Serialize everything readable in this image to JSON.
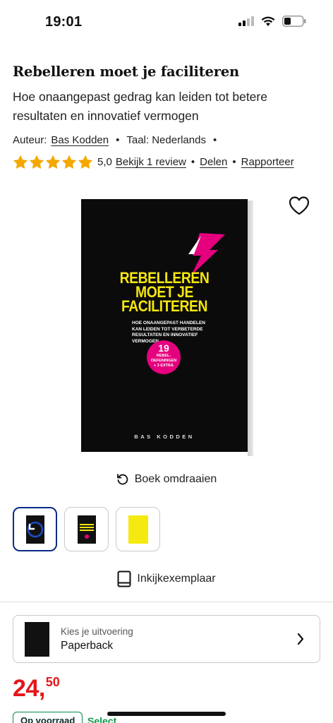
{
  "status_bar": {
    "time": "19:01"
  },
  "product": {
    "title": "Rebelleren moet je faciliteren",
    "subtitle": "Hoe onaangepast gedrag kan leiden tot betere resultaten en innovatief vermogen",
    "author_label": "Auteur:",
    "author": "Bas Kodden",
    "language_label": "Taal: Nederlands",
    "separator": "•",
    "rating": "5,0",
    "stars": 5,
    "review_link": "Bekijk 1 review",
    "share_link": "Delen",
    "report_link": "Rapporteer"
  },
  "cover": {
    "title_line1": "REBELLEREN",
    "title_line2": "MOET JE",
    "title_line3": "FACILITEREN",
    "sub1": "HOE ONAANGEPAST HANDELEN",
    "sub2": "KAN LEIDEN TOT VERBETERDE",
    "sub3": "RESULTATEN EN INNOVATIEF",
    "sub4": "VERMOGEN",
    "badge_num": "19",
    "badge_line1": "REBEL-",
    "badge_line2": "OEFENINGEN",
    "badge_line3": "+ 3 EXTRA",
    "author": "BAS KODDEN"
  },
  "actions": {
    "flip_label": "Boek omdraaien",
    "preview_label": "Inkijkexemplaar"
  },
  "variant": {
    "label": "Kies je uitvoering",
    "value": "Paperback"
  },
  "price": {
    "main": "24,",
    "cents": "50"
  },
  "stock": {
    "badge": "Op voorraad",
    "select": "Select"
  },
  "colors": {
    "accent_blue": "#0a2a8a",
    "price_red": "#e4161a",
    "star_yellow": "#f5a800",
    "cover_yellow": "#f5e60f",
    "cover_pink": "#e5007e"
  }
}
